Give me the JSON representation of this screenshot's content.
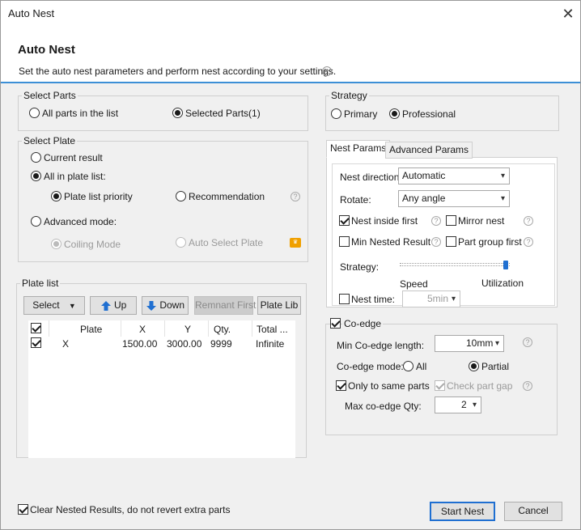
{
  "window": {
    "title": "Auto Nest",
    "close": "✕"
  },
  "header": {
    "title": "Auto Nest",
    "description": "Set the auto nest parameters and perform nest according to your settings."
  },
  "select_parts": {
    "label": "Select Parts",
    "options": [
      "All parts in the list",
      "Selected Parts(1)"
    ],
    "selected": "Selected Parts(1)"
  },
  "select_plate": {
    "label": "Select Plate",
    "current_result": "Current result",
    "all_in_plate_list": "All in plate list:",
    "plate_list_priority": "Plate list priority",
    "recommendation": "Recommendation",
    "advanced_mode": "Advanced mode:",
    "coiling_mode": "Coiling Mode",
    "auto_select_plate": "Auto Select Plate"
  },
  "plate_list": {
    "label": "Plate list",
    "buttons": {
      "select": "Select",
      "up": "Up",
      "down": "Down",
      "remnant_first": "Remnant First",
      "plate_lib": "Plate Lib"
    },
    "columns": [
      "Plate",
      "X",
      "Y",
      "Qty.",
      "Total ..."
    ],
    "rows": [
      {
        "checked": true,
        "plate": "X",
        "x": "1500.00",
        "y": "3000.00",
        "qty": "9999",
        "total": "Infinite"
      }
    ]
  },
  "strategy": {
    "label": "Strategy",
    "options": [
      "Primary",
      "Professional"
    ],
    "selected": "Professional"
  },
  "tabs": [
    "Nest Params",
    "Advanced Params"
  ],
  "nest_params": {
    "nest_direction_label": "Nest direction",
    "nest_direction_value": "Automatic",
    "rotate_label": "Rotate:",
    "rotate_value": "Any angle",
    "nest_inside_first": "Nest inside first",
    "mirror_nest": "Mirror nest",
    "min_nested_result": "Min Nested Result",
    "part_group_first": "Part group first",
    "strategy_label": "Strategy:",
    "speed_label": "Speed",
    "utilization_label": "Utilization",
    "strategy_level": 1.0,
    "nest_time_label": "Nest time:",
    "nest_time_value": "5min"
  },
  "coedge": {
    "label": "Co-edge",
    "min_length_label": "Min Co-edge length:",
    "min_length_value": "10mm",
    "mode_label": "Co-edge mode:",
    "mode_all": "All",
    "mode_partial": "Partial",
    "only_same_parts": "Only to same parts",
    "check_part_gap": "Check part gap",
    "max_qty_label": "Max co-edge Qty:",
    "max_qty_value": "2"
  },
  "footer": {
    "clear_nested": "Clear Nested Results, do not revert extra parts",
    "start_nest": "Start Nest",
    "cancel": "Cancel"
  },
  "colors": {
    "accent": "#3c8fd6",
    "arrow_blue": "#1f6fd1",
    "vip": "#f0a000"
  }
}
